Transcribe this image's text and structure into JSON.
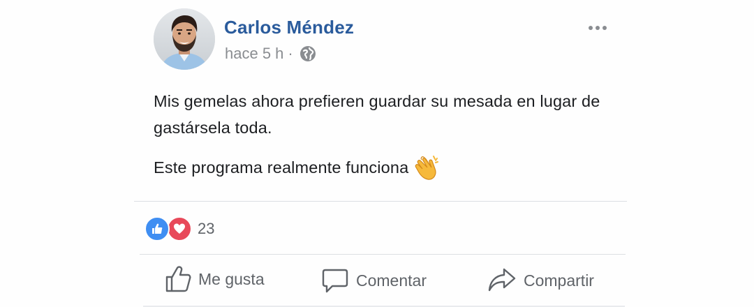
{
  "post": {
    "author": "Carlos Méndez",
    "time": "hace 5 h",
    "separator": "·",
    "privacy_icon": "globe-icon",
    "options_icon": "more-horizontal-icon",
    "text_line1": "Mis gemelas ahora prefieren guardar su mesada en lugar de gastársela toda.",
    "text_line2": "Este programa realmente funciona",
    "emoji": "clapping-hands-emoji"
  },
  "reactions": {
    "icons": [
      "like-reaction-icon",
      "love-reaction-icon"
    ],
    "count": "23"
  },
  "actions": {
    "like_label": "Me gusta",
    "comment_label": "Comentar",
    "share_label": "Compartir"
  },
  "colors": {
    "author_link": "#2a5b9c",
    "muted_text": "#8a8d91",
    "like_blue": "#3f8ef2",
    "love_red": "#e8495a"
  }
}
